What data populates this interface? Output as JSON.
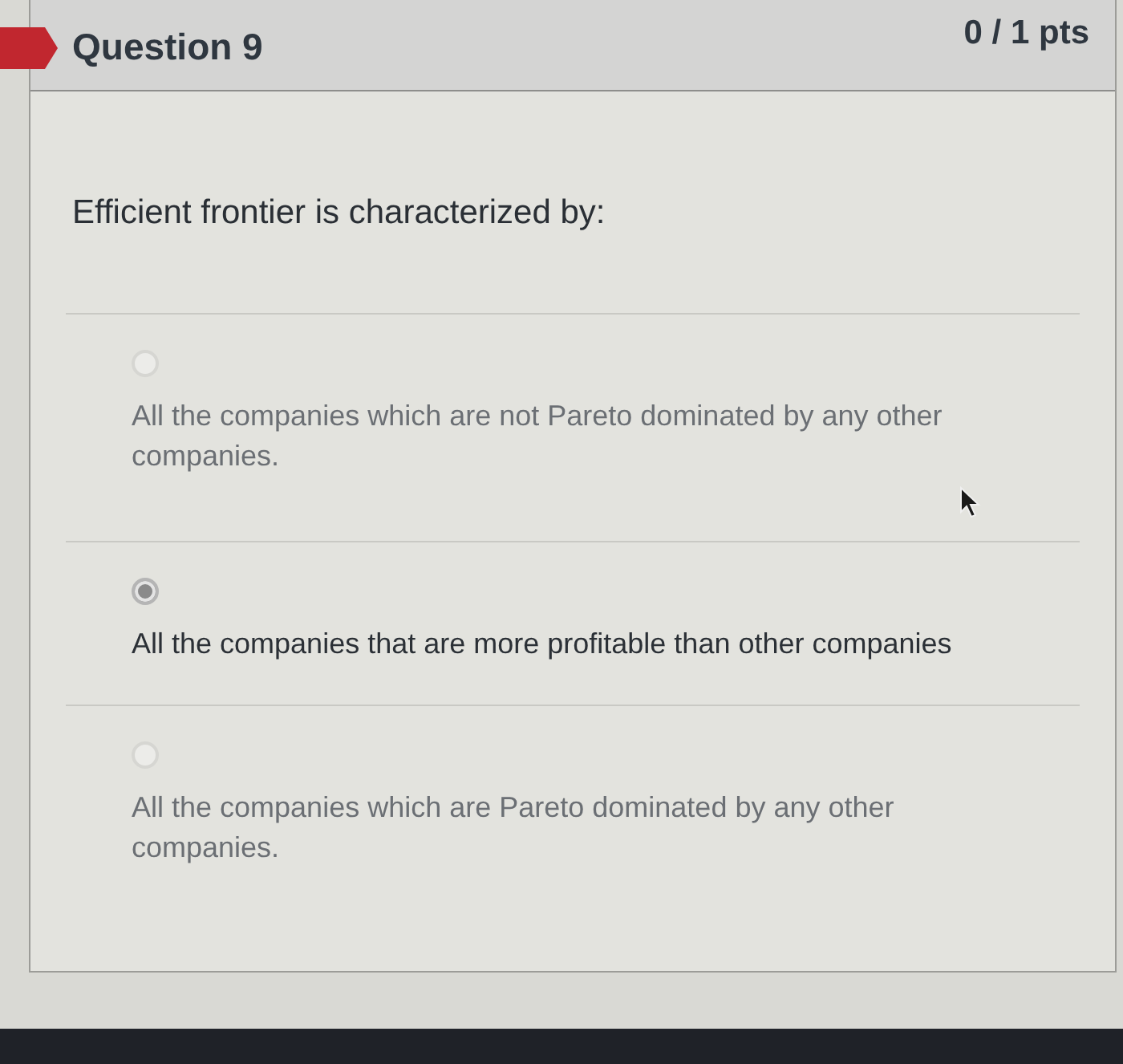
{
  "question": {
    "title": "Question 9",
    "points": "0 / 1 pts",
    "text": "Efficient frontier is characterized by:"
  },
  "options": [
    {
      "text": "All the companies which are not Pareto dominated by any other companies.",
      "selected": false
    },
    {
      "text": "All the companies that are more profitable than other companies",
      "selected": true
    },
    {
      "text": "All the companies which are Pareto dominated by any other companies.",
      "selected": false
    }
  ]
}
